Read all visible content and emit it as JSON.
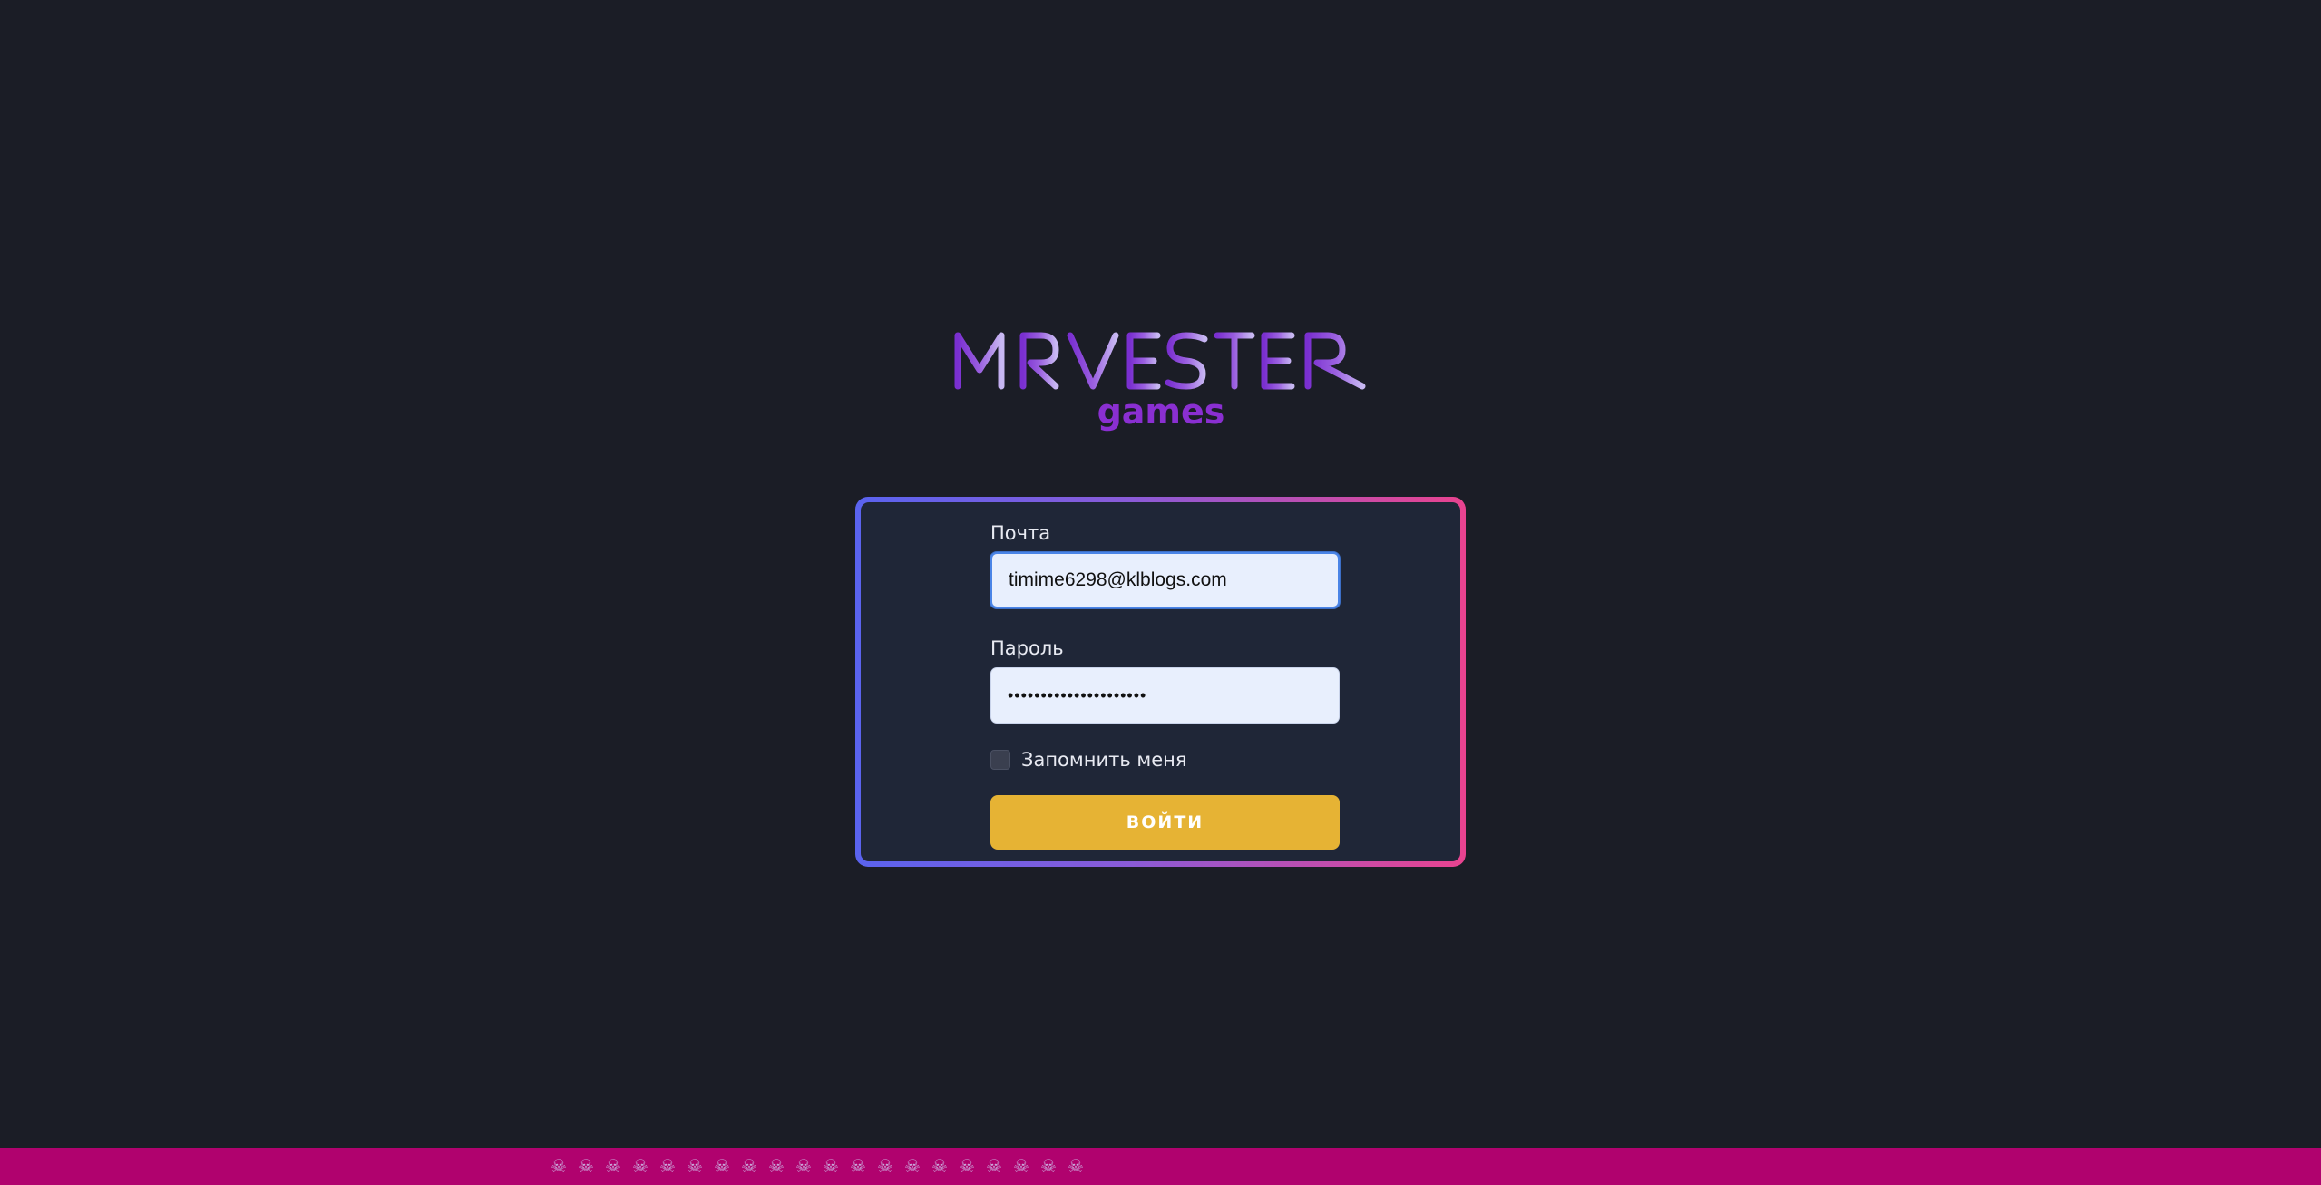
{
  "logo": {
    "main": "MRVESTER",
    "sub": "games",
    "colors": [
      "#7a2fd0",
      "#8d4fdc",
      "#a67fe6",
      "#c3b2f0"
    ]
  },
  "login": {
    "email_label": "Почта",
    "email_value": "timime6298@klblogs.com",
    "password_label": "Пароль",
    "password_value": "•••••••••••••••••••••",
    "remember_label": "Запомнить меня",
    "remember_checked": false,
    "submit_label": "ВОЙТИ"
  },
  "bottom_bar": {
    "icon": "skull-crossbones-icon",
    "color": "#b0026e",
    "icon_count": 20
  }
}
